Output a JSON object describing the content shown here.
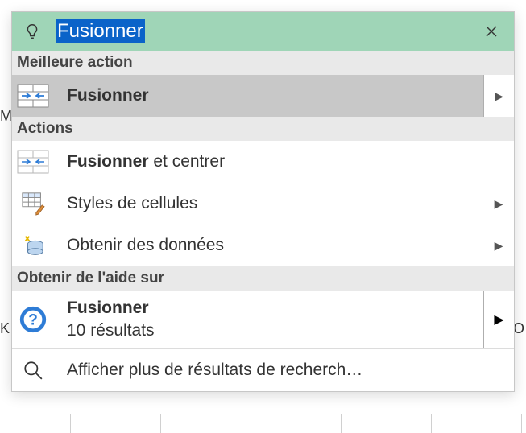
{
  "search": {
    "query": "Fusionner",
    "close_aria": "Fermer"
  },
  "sections": {
    "best_action_header": "Meilleure action",
    "actions_header": "Actions",
    "help_header": "Obtenir de l'aide sur"
  },
  "best_action": {
    "label": "Fusionner"
  },
  "actions": [
    {
      "bold": "Fusionner",
      "rest": " et centrer",
      "has_submenu": false
    },
    {
      "bold": "",
      "rest": "Styles de cellules",
      "has_submenu": true
    },
    {
      "bold": "",
      "rest": "Obtenir des données",
      "has_submenu": true
    }
  ],
  "help": {
    "title_bold": "Fusionner",
    "subtitle": "10 résultats"
  },
  "more_results": {
    "label": "Afficher plus de résultats de recherch…"
  },
  "bleed": {
    "left": "Mi",
    "k": "K",
    "o": "O"
  },
  "icons": {
    "bulb": "bulb-icon",
    "close": "close-icon",
    "merge": "merge-icon",
    "merge_center": "merge-center-icon",
    "cell_styles": "cell-styles-icon",
    "get_data": "get-data-icon",
    "help": "help-icon",
    "search": "search-icon",
    "chevron": "chevron-right-icon"
  },
  "colors": {
    "search_bg": "#9fd5b7",
    "excel_green": "#217346"
  }
}
